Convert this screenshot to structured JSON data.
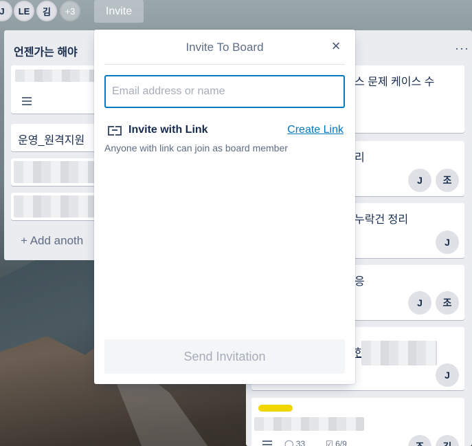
{
  "header": {
    "avatars": [
      {
        "initials": "J"
      },
      {
        "initials": "LE"
      },
      {
        "initials": "김"
      },
      {
        "initials": "+3"
      }
    ],
    "invite_label": "Invite"
  },
  "board": {
    "left_list": {
      "title": "언젠가는 해야",
      "cards": [
        {
          "text": "운영_원격지원"
        }
      ],
      "add_label": "+ Add anoth"
    },
    "right_list": {
      "menu": "···",
      "cards": [
        {
          "text": "스 문제 케이스 수"
        },
        {
          "text": "리",
          "members": [
            "J",
            "조"
          ]
        },
        {
          "text": "누락건 정리",
          "members": [
            "J"
          ]
        },
        {
          "text": "응",
          "members": [
            "J",
            "조"
          ]
        },
        {
          "text": "한",
          "members": [
            "J"
          ]
        }
      ],
      "last_card": {
        "comments": "33",
        "checklist": "6/9",
        "members": [
          "조",
          "김"
        ]
      }
    }
  },
  "popover": {
    "title": "Invite To Board",
    "close_icon": "close-icon",
    "search": {
      "placeholder": "Email address or name",
      "value": ""
    },
    "invite_link_label": "Invite with Link",
    "create_link_label": "Create Link",
    "invite_description": "Anyone with link can join as board member",
    "send_label": "Send Invitation"
  },
  "colors": {
    "accent": "#0079bf",
    "label_yellow": "#f2d600"
  }
}
